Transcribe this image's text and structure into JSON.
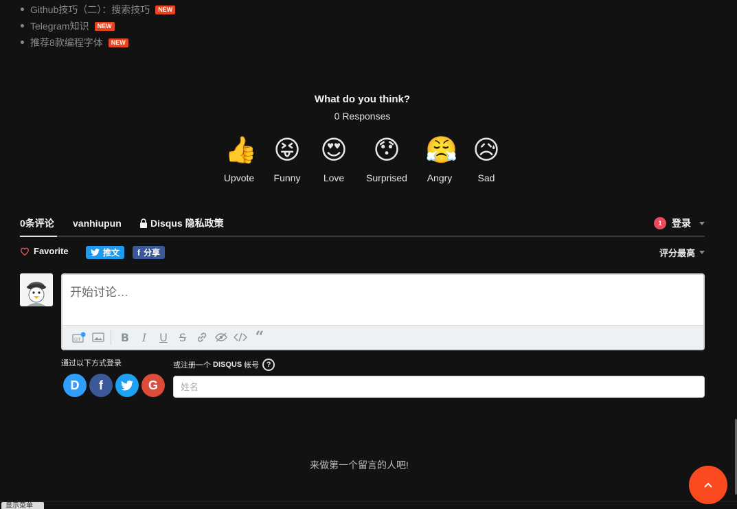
{
  "related_posts": [
    {
      "title": "Github技巧（二）：搜索技巧",
      "badge": "NEW"
    },
    {
      "title": "Telegram知识",
      "badge": "NEW"
    },
    {
      "title": "推荐8款编程字体",
      "badge": "NEW"
    }
  ],
  "reactions": {
    "question": "What do you think?",
    "responses": "0 Responses",
    "items": [
      {
        "label": "Upvote",
        "emoji": "👍"
      },
      {
        "label": "Funny",
        "emoji": "😝"
      },
      {
        "label": "Love",
        "emoji": "😍"
      },
      {
        "label": "Surprised",
        "emoji": "😯"
      },
      {
        "label": "Angry",
        "emoji": "😤"
      },
      {
        "label": "Sad",
        "emoji": "😥"
      }
    ]
  },
  "disqus": {
    "tabs": {
      "comments": "0条评论",
      "site": "vanhiupun",
      "privacy": "Disqus 隐私政策"
    },
    "login": {
      "badge": "1",
      "label": "登录"
    },
    "favorite": "Favorite",
    "tweet": "推文",
    "share": "分享",
    "sort": "评分最高",
    "composer_placeholder": "开始讨论…",
    "login_with": "通过以下方式登录",
    "signup_prefix": "或注册一个",
    "signup_brand": "DISQUS",
    "signup_suffix": "帐号",
    "help": "?",
    "name_placeholder": "姓名",
    "empty_message": "来做第一个留言的人吧!"
  },
  "ui": {
    "menu_button": "显示菜单",
    "accent_color": "#fc4a20"
  }
}
